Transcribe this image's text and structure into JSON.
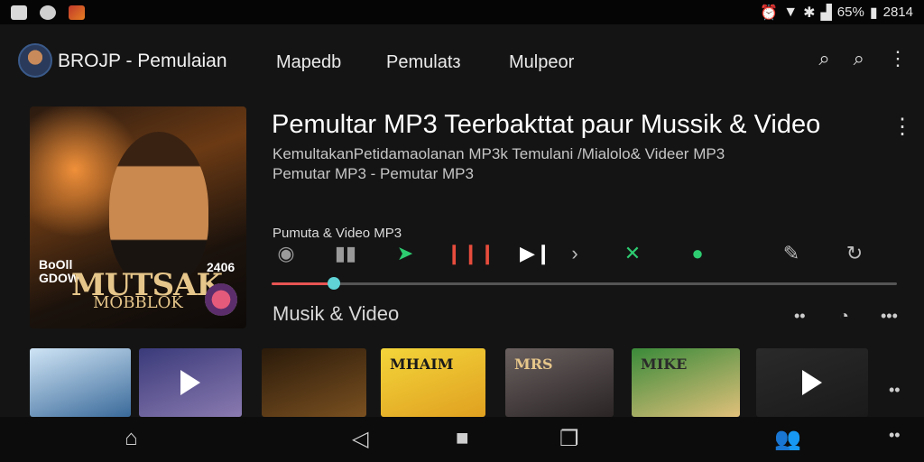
{
  "status_bar": {
    "battery": "65%",
    "clock": "2814",
    "icons": [
      "screenshot-icon",
      "settings-icon",
      "photo-icon",
      "alarm-icon",
      "wifi-icon",
      "bluetooth-icon",
      "signal-icon",
      "battery-icon"
    ]
  },
  "header": {
    "app_title": "BROJP - Pemulaian",
    "tabs": [
      "Mapedb",
      "Pemulatз",
      "Mulpeor"
    ],
    "icons": [
      "search-icon",
      "search-icon",
      "more-icon"
    ]
  },
  "now_playing": {
    "title": "Pemultar MP3 Teerbakttat paur  Mussik & Video",
    "subtitle_1": "KemultakanPetidamaolanan MP3k Temulani /Mialolo& Videer MP3",
    "subtitle_2": "Pemutar MP3 - Pemutar MP3",
    "album_art": {
      "cover_text": "MUTSAK",
      "cover_sub": "MOBBLOK",
      "side_text": "BoOll\nGDOW",
      "year": "2406"
    },
    "controls_label": "Pumuta  & Video MP3",
    "controls": [
      {
        "name": "camera-icon",
        "glyph": "◉",
        "color": "#9a9a9a"
      },
      {
        "name": "tag-icon",
        "glyph": "▮▮",
        "color": "#9a9a9a"
      },
      {
        "name": "share-icon",
        "glyph": "➤",
        "color": "#2ecc71"
      },
      {
        "name": "equalizer-icon",
        "glyph": "❙❙❙",
        "color": "#e74c3c"
      },
      {
        "name": "next-icon",
        "glyph": "▶❙",
        "color": "#ffffff"
      },
      {
        "name": "chevron-right-icon",
        "glyph": "›",
        "color": "#bbbbbb"
      },
      {
        "name": "shuffle-icon",
        "glyph": "✕",
        "color": "#2ecc71"
      },
      {
        "name": "chat-icon",
        "glyph": "●",
        "color": "#2ecc71"
      },
      {
        "name": "mic-icon",
        "glyph": "✎",
        "color": "#bbbbbb"
      },
      {
        "name": "repeat-icon",
        "glyph": "↻",
        "color": "#bbbbbb"
      }
    ],
    "progress_fraction": 0.1
  },
  "section": {
    "title": "Musik & Video"
  },
  "playlist": [
    {
      "name": "playlist-thumb-1",
      "bg": "linear-gradient(160deg,#cfe4f5,#3a6a9a)",
      "text": ""
    },
    {
      "name": "playlist-thumb-2",
      "bg": "linear-gradient(160deg,#3a3a7a,#8a7ab0)",
      "text": "",
      "play": true
    },
    {
      "name": "playlist-thumb-3",
      "bg": "linear-gradient(160deg,#2a1a0a,#7a5020)",
      "text": ""
    },
    {
      "name": "playlist-thumb-4",
      "bg": "linear-gradient(160deg,#f3d53a,#e0a020)",
      "text": "MHAIM",
      "text_color": "#1a1a1a"
    },
    {
      "name": "playlist-thumb-5",
      "bg": "linear-gradient(160deg,#6a6060,#2a2424)",
      "text": "MRS",
      "text_color": "#e6c68a"
    },
    {
      "name": "playlist-thumb-6",
      "bg": "linear-gradient(160deg,#3a8a3a,#e0c07a)",
      "text": "MIKE",
      "text_color": "#2a2a2a"
    },
    {
      "name": "playlist-thumb-7",
      "bg": "linear-gradient(160deg,#2a2a2a,#1a1a1a)",
      "text": "",
      "play": true
    }
  ],
  "bottom_nav": {
    "icons": [
      "home-icon",
      "back-icon",
      "home-button-icon",
      "recents-icon",
      "people-icon",
      "more-icon"
    ]
  },
  "colors": {
    "accent": "#e85454",
    "knob": "#5fd3d6",
    "background": "#141414"
  }
}
